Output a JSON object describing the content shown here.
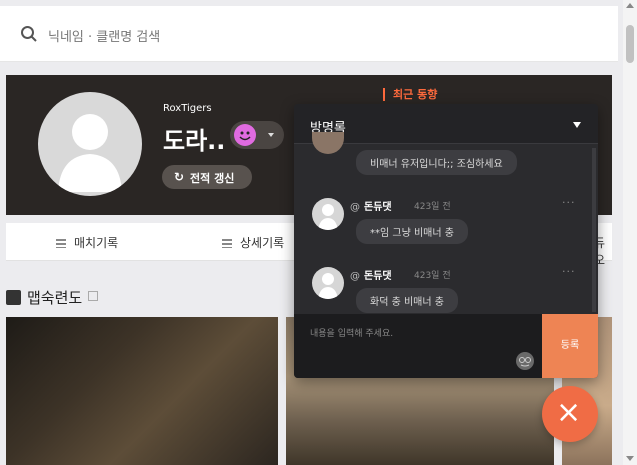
{
  "search": {
    "placeholder": "닉네임 · 클랜명 검색"
  },
  "profile": {
    "team": "RoxTigers",
    "name": "도라..",
    "refresh_icon": "↻",
    "refresh_label": "전적 갱신",
    "recent_label": "최근 동향"
  },
  "tabs": [
    {
      "label": "매치기록"
    },
    {
      "label": "상세기록"
    },
    {
      "label": "듀오"
    }
  ],
  "map_section": {
    "title": "맵숙련도"
  },
  "guestbook": {
    "title": "방명록",
    "entries": [
      {
        "message": "비매너 유저입니다;; 조심하세요"
      },
      {
        "author": "돈듀댓",
        "time": "423일 전",
        "more": "···",
        "message": "**임 그냥 비매너 충"
      },
      {
        "author": "돈듀댓",
        "time": "423일 전",
        "more": "···",
        "message": "화덕 충 비매너 충"
      }
    ],
    "input_placeholder": "내용을 입력해 주세요.",
    "submit_label": "등록"
  },
  "fab": {
    "icon": "×"
  }
}
